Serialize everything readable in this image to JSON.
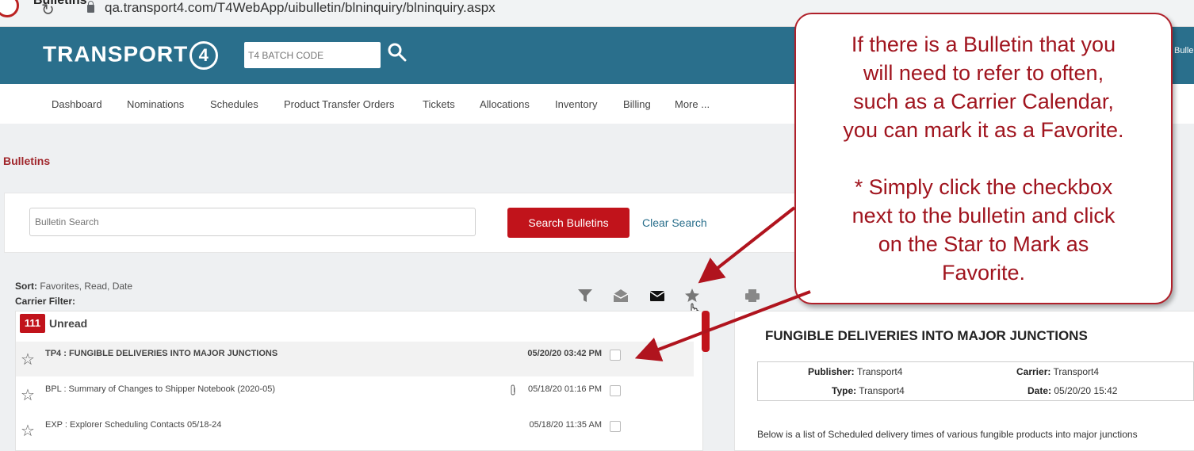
{
  "browser": {
    "tab_title": "Bulletins",
    "url": "qa.transport4.com/T4WebApp/uibulletin/blninquiry/blninquiry.aspx"
  },
  "header": {
    "logo_text": "TRANSPORT",
    "logo_mark": "4",
    "batch_placeholder": "T4 BATCH CODE",
    "right_text": "Bulle",
    "brand_color": "#2a6f8c"
  },
  "nav": {
    "items": [
      "Dashboard",
      "Nominations",
      "Schedules",
      "Product Transfer Orders",
      "Tickets",
      "Allocations",
      "Inventory",
      "Billing",
      "More ..."
    ]
  },
  "page": {
    "title": "Bulletins",
    "search_placeholder": "Bulletin Search",
    "search_button": "Search Bulletins",
    "clear_search": "Clear Search",
    "sort_label": "Sort:",
    "sort_value": "Favorites, Read, Date",
    "carrier_filter": "Carrier Filter:",
    "accent_color": "#c1131b"
  },
  "toolbar_icons": [
    "filter-icon",
    "envelope-open-icon",
    "envelope-icon",
    "star-icon",
    "printer-icon"
  ],
  "list": {
    "count": "111",
    "group_label": "Unread",
    "rows": [
      {
        "title": "TP4 : FUNGIBLE DELIVERIES INTO MAJOR JUNCTIONS",
        "date": "05/20/20 03:42 PM",
        "attachment": false
      },
      {
        "title": "BPL : Summary of Changes to Shipper Notebook (2020-05)",
        "date": "05/18/20 01:16 PM",
        "attachment": true
      },
      {
        "title": "EXP : Explorer Scheduling Contacts 05/18-24",
        "date": "05/18/20 11:35 AM",
        "attachment": false
      }
    ]
  },
  "detail": {
    "title": "FUNGIBLE DELIVERIES INTO MAJOR JUNCTIONS",
    "publisher_label": "Publisher:",
    "publisher": "Transport4",
    "carrier_label": "Carrier:",
    "carrier": "Transport4",
    "type_label": "Type:",
    "type": "Transport4",
    "date_label": "Date:",
    "date": "05/20/20 15:42",
    "body": "Below is a list of Scheduled delivery times of various fungible products into major junctions"
  },
  "callout": {
    "line1": "If there is a Bulletin that you",
    "line2": "will need to refer to often,",
    "line3": "such as a Carrier Calendar,",
    "line4": "you can mark it as a Favorite.",
    "line5": "* Simply click the checkbox",
    "line6": "next to the bulletin and click",
    "line7": "on the Star to Mark as",
    "line8": "Favorite.",
    "color": "#a0141e"
  }
}
